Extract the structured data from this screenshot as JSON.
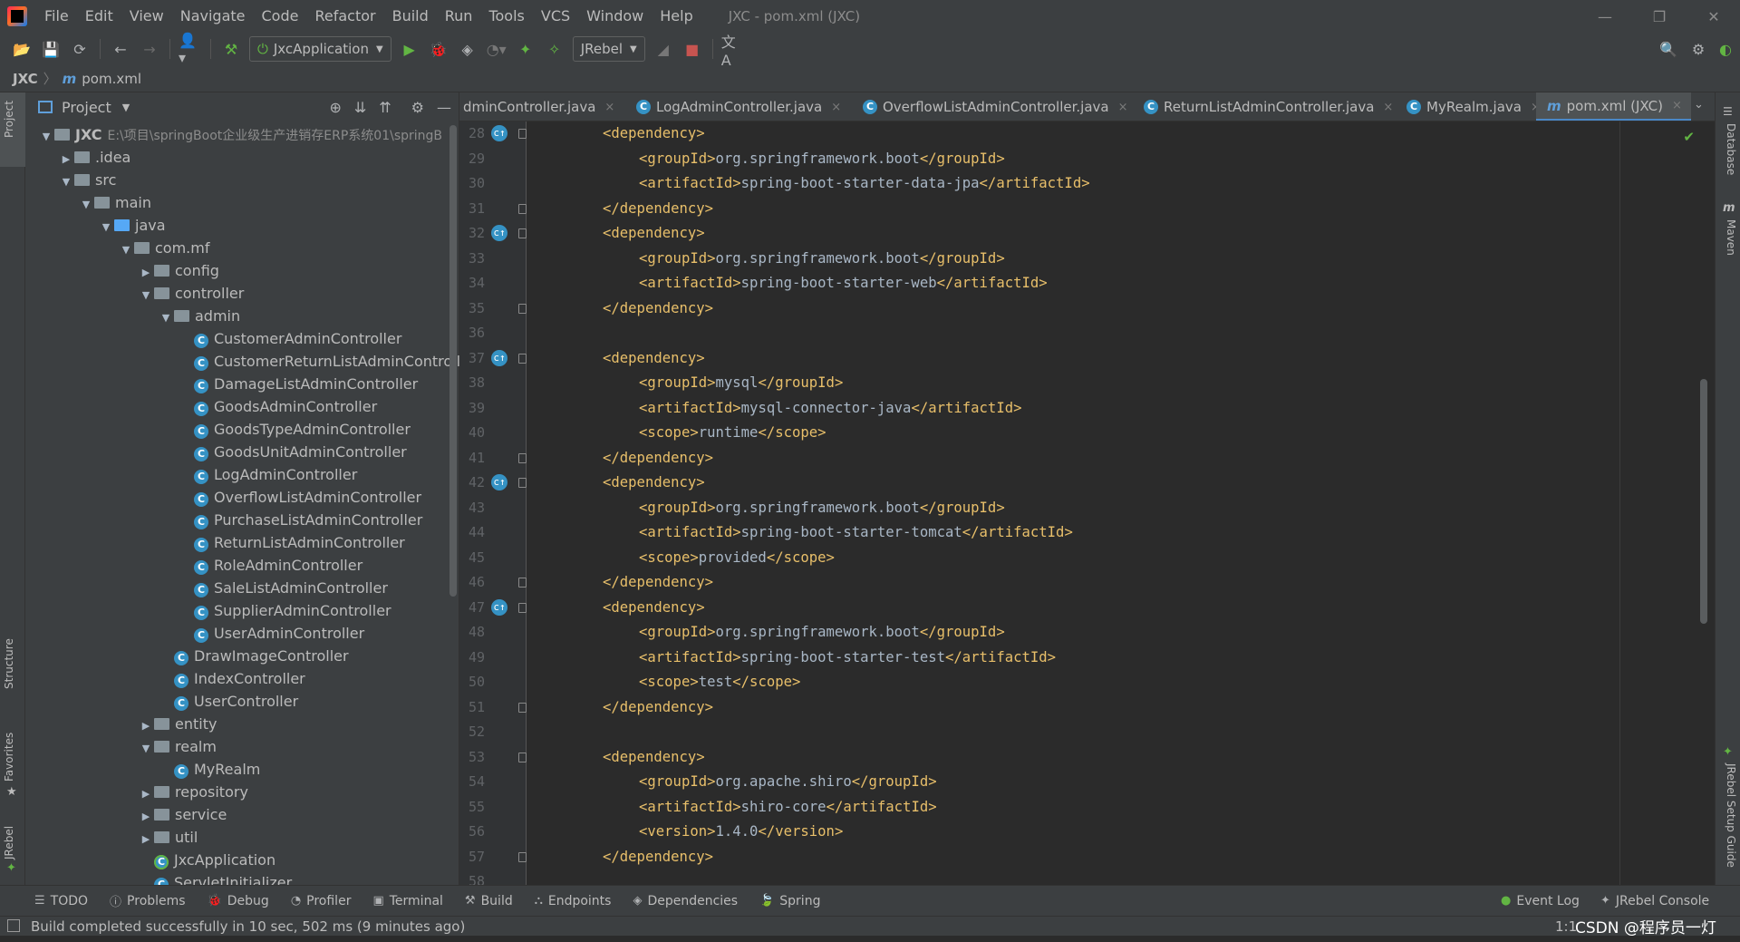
{
  "menu": {
    "items": [
      "File",
      "Edit",
      "View",
      "Navigate",
      "Code",
      "Refactor",
      "Build",
      "Run",
      "Tools",
      "VCS",
      "Window",
      "Help"
    ],
    "window_title": "JXC - pom.xml (JXC)"
  },
  "toolbar": {
    "run_config": "JxcApplication",
    "jrebel_config": "JRebel"
  },
  "breadcrumb": {
    "project": "JXC",
    "file": "pom.xml"
  },
  "left_stripe": {
    "project": "Project",
    "structure": "Structure",
    "favorites": "Favorites",
    "jrebel": "JRebel"
  },
  "right_stripe": {
    "database": "Database",
    "maven": "Maven",
    "jrebel_guide": "JRebel Setup Guide"
  },
  "project_panel": {
    "title": "Project",
    "tree": [
      {
        "label": "JXC",
        "hint": "E:\\项目\\springBoot企业级生产进销存ERP系统01\\springB",
        "kind": "module",
        "depth": 0,
        "arrow": "open"
      },
      {
        "label": ".idea",
        "kind": "folder",
        "depth": 1,
        "arrow": "closed"
      },
      {
        "label": "src",
        "kind": "folder",
        "depth": 1,
        "arrow": "open"
      },
      {
        "label": "main",
        "kind": "folder",
        "depth": 2,
        "arrow": "open"
      },
      {
        "label": "java",
        "kind": "srcfolder",
        "depth": 3,
        "arrow": "open"
      },
      {
        "label": "com.mf",
        "kind": "folder",
        "depth": 4,
        "arrow": "open"
      },
      {
        "label": "config",
        "kind": "folder",
        "depth": 5,
        "arrow": "closed"
      },
      {
        "label": "controller",
        "kind": "folder",
        "depth": 5,
        "arrow": "open"
      },
      {
        "label": "admin",
        "kind": "folder",
        "depth": 6,
        "arrow": "open"
      },
      {
        "label": "CustomerAdminController",
        "kind": "class",
        "depth": 7
      },
      {
        "label": "CustomerReturnListAdminController",
        "kind": "class",
        "depth": 7
      },
      {
        "label": "DamageListAdminController",
        "kind": "class",
        "depth": 7
      },
      {
        "label": "GoodsAdminController",
        "kind": "class",
        "depth": 7
      },
      {
        "label": "GoodsTypeAdminController",
        "kind": "class",
        "depth": 7
      },
      {
        "label": "GoodsUnitAdminController",
        "kind": "class",
        "depth": 7
      },
      {
        "label": "LogAdminController",
        "kind": "class",
        "depth": 7
      },
      {
        "label": "OverflowListAdminController",
        "kind": "class",
        "depth": 7
      },
      {
        "label": "PurchaseListAdminController",
        "kind": "class",
        "depth": 7
      },
      {
        "label": "ReturnListAdminController",
        "kind": "class",
        "depth": 7
      },
      {
        "label": "RoleAdminController",
        "kind": "class",
        "depth": 7
      },
      {
        "label": "SaleListAdminController",
        "kind": "class",
        "depth": 7
      },
      {
        "label": "SupplierAdminController",
        "kind": "class",
        "depth": 7
      },
      {
        "label": "UserAdminController",
        "kind": "class",
        "depth": 7
      },
      {
        "label": "DrawImageController",
        "kind": "class",
        "depth": 6
      },
      {
        "label": "IndexController",
        "kind": "class",
        "depth": 6
      },
      {
        "label": "UserController",
        "kind": "class",
        "depth": 6
      },
      {
        "label": "entity",
        "kind": "folder",
        "depth": 5,
        "arrow": "closed"
      },
      {
        "label": "realm",
        "kind": "folder",
        "depth": 5,
        "arrow": "open"
      },
      {
        "label": "MyRealm",
        "kind": "class",
        "depth": 6
      },
      {
        "label": "repository",
        "kind": "folder",
        "depth": 5,
        "arrow": "closed"
      },
      {
        "label": "service",
        "kind": "folder",
        "depth": 5,
        "arrow": "closed"
      },
      {
        "label": "util",
        "kind": "folder",
        "depth": 5,
        "arrow": "closed"
      },
      {
        "label": "JxcApplication",
        "kind": "bootclass",
        "depth": 5
      },
      {
        "label": "ServletInitializer",
        "kind": "class",
        "depth": 5
      }
    ]
  },
  "tabs": [
    {
      "label": "dminController.java",
      "icon": "class"
    },
    {
      "label": "LogAdminController.java",
      "icon": "class"
    },
    {
      "label": "OverflowListAdminController.java",
      "icon": "class"
    },
    {
      "label": "ReturnListAdminController.java",
      "icon": "class"
    },
    {
      "label": "MyRealm.java",
      "icon": "class"
    },
    {
      "label": "pom.xml (JXC)",
      "icon": "maven",
      "active": true
    }
  ],
  "editor": {
    "lines": [
      {
        "n": "28",
        "indent": 2,
        "parts": [
          [
            "tag",
            "<dependency>"
          ]
        ],
        "gicon": true,
        "fold": true
      },
      {
        "n": "29",
        "indent": 3,
        "parts": [
          [
            "tag",
            "<groupId>"
          ],
          [
            "txt",
            "org.springframework.boot"
          ],
          [
            "tag",
            "</groupId>"
          ]
        ]
      },
      {
        "n": "30",
        "indent": 3,
        "parts": [
          [
            "tag",
            "<artifactId>"
          ],
          [
            "txt",
            "spring-boot-starter-data-jpa"
          ],
          [
            "tag",
            "</artifactId>"
          ]
        ]
      },
      {
        "n": "31",
        "indent": 2,
        "parts": [
          [
            "tag",
            "</dependency>"
          ]
        ],
        "fold": true
      },
      {
        "n": "32",
        "indent": 2,
        "parts": [
          [
            "tag",
            "<dependency>"
          ]
        ],
        "gicon": true,
        "fold": true
      },
      {
        "n": "33",
        "indent": 3,
        "parts": [
          [
            "tag",
            "<groupId>"
          ],
          [
            "txt",
            "org.springframework.boot"
          ],
          [
            "tag",
            "</groupId>"
          ]
        ]
      },
      {
        "n": "34",
        "indent": 3,
        "parts": [
          [
            "tag",
            "<artifactId>"
          ],
          [
            "txt",
            "spring-boot-starter-web"
          ],
          [
            "tag",
            "</artifactId>"
          ]
        ]
      },
      {
        "n": "35",
        "indent": 2,
        "parts": [
          [
            "tag",
            "</dependency>"
          ]
        ],
        "fold": true
      },
      {
        "n": "36",
        "indent": 0,
        "parts": []
      },
      {
        "n": "37",
        "indent": 2,
        "parts": [
          [
            "tag",
            "<dependency>"
          ]
        ],
        "gicon": true,
        "fold": true
      },
      {
        "n": "38",
        "indent": 3,
        "parts": [
          [
            "tag",
            "<groupId>"
          ],
          [
            "txt",
            "mysql"
          ],
          [
            "tag",
            "</groupId>"
          ]
        ]
      },
      {
        "n": "39",
        "indent": 3,
        "parts": [
          [
            "tag",
            "<artifactId>"
          ],
          [
            "txt",
            "mysql-connector-java"
          ],
          [
            "tag",
            "</artifactId>"
          ]
        ]
      },
      {
        "n": "40",
        "indent": 3,
        "parts": [
          [
            "tag",
            "<scope>"
          ],
          [
            "txt",
            "runtime"
          ],
          [
            "tag",
            "</scope>"
          ]
        ]
      },
      {
        "n": "41",
        "indent": 2,
        "parts": [
          [
            "tag",
            "</dependency>"
          ]
        ],
        "fold": true
      },
      {
        "n": "42",
        "indent": 2,
        "parts": [
          [
            "tag",
            "<dependency>"
          ]
        ],
        "gicon": true,
        "fold": true
      },
      {
        "n": "43",
        "indent": 3,
        "parts": [
          [
            "tag",
            "<groupId>"
          ],
          [
            "txt",
            "org.springframework.boot"
          ],
          [
            "tag",
            "</groupId>"
          ]
        ]
      },
      {
        "n": "44",
        "indent": 3,
        "parts": [
          [
            "tag",
            "<artifactId>"
          ],
          [
            "txt",
            "spring-boot-starter-tomcat"
          ],
          [
            "tag",
            "</artifactId>"
          ]
        ]
      },
      {
        "n": "45",
        "indent": 3,
        "parts": [
          [
            "tag",
            "<scope>"
          ],
          [
            "txt",
            "provided"
          ],
          [
            "tag",
            "</scope>"
          ]
        ]
      },
      {
        "n": "46",
        "indent": 2,
        "parts": [
          [
            "tag",
            "</dependency>"
          ]
        ],
        "fold": true
      },
      {
        "n": "47",
        "indent": 2,
        "parts": [
          [
            "tag",
            "<dependency>"
          ]
        ],
        "gicon": true,
        "fold": true
      },
      {
        "n": "48",
        "indent": 3,
        "parts": [
          [
            "tag",
            "<groupId>"
          ],
          [
            "txt",
            "org.springframework.boot"
          ],
          [
            "tag",
            "</groupId>"
          ]
        ]
      },
      {
        "n": "49",
        "indent": 3,
        "parts": [
          [
            "tag",
            "<artifactId>"
          ],
          [
            "txt",
            "spring-boot-starter-test"
          ],
          [
            "tag",
            "</artifactId>"
          ]
        ]
      },
      {
        "n": "50",
        "indent": 3,
        "parts": [
          [
            "tag",
            "<scope>"
          ],
          [
            "txt",
            "test"
          ],
          [
            "tag",
            "</scope>"
          ]
        ]
      },
      {
        "n": "51",
        "indent": 2,
        "parts": [
          [
            "tag",
            "</dependency>"
          ]
        ],
        "fold": true
      },
      {
        "n": "52",
        "indent": 0,
        "parts": []
      },
      {
        "n": "53",
        "indent": 2,
        "parts": [
          [
            "tag",
            "<dependency>"
          ]
        ],
        "fold": true
      },
      {
        "n": "54",
        "indent": 3,
        "parts": [
          [
            "tag",
            "<groupId>"
          ],
          [
            "txt",
            "org.apache.shiro"
          ],
          [
            "tag",
            "</groupId>"
          ]
        ]
      },
      {
        "n": "55",
        "indent": 3,
        "parts": [
          [
            "tag",
            "<artifactId>"
          ],
          [
            "txt",
            "shiro-core"
          ],
          [
            "tag",
            "</artifactId>"
          ]
        ]
      },
      {
        "n": "56",
        "indent": 3,
        "parts": [
          [
            "tag",
            "<version>"
          ],
          [
            "txt",
            "1.4.0"
          ],
          [
            "tag",
            "</version>"
          ]
        ]
      },
      {
        "n": "57",
        "indent": 2,
        "parts": [
          [
            "tag",
            "</dependency>"
          ]
        ],
        "fold": true
      },
      {
        "n": "58",
        "indent": 0,
        "parts": []
      }
    ]
  },
  "bottom_tools": {
    "items": [
      "TODO",
      "Problems",
      "Debug",
      "Profiler",
      "Terminal",
      "Build",
      "Endpoints",
      "Dependencies",
      "Spring"
    ],
    "event_log": "Event Log",
    "jrebel_console": "JRebel Console"
  },
  "status": {
    "message": "Build completed successfully in 10 sec, 502 ms (9 minutes ago)",
    "position": "1:1",
    "watermark": "CSDN @程序员一灯"
  }
}
